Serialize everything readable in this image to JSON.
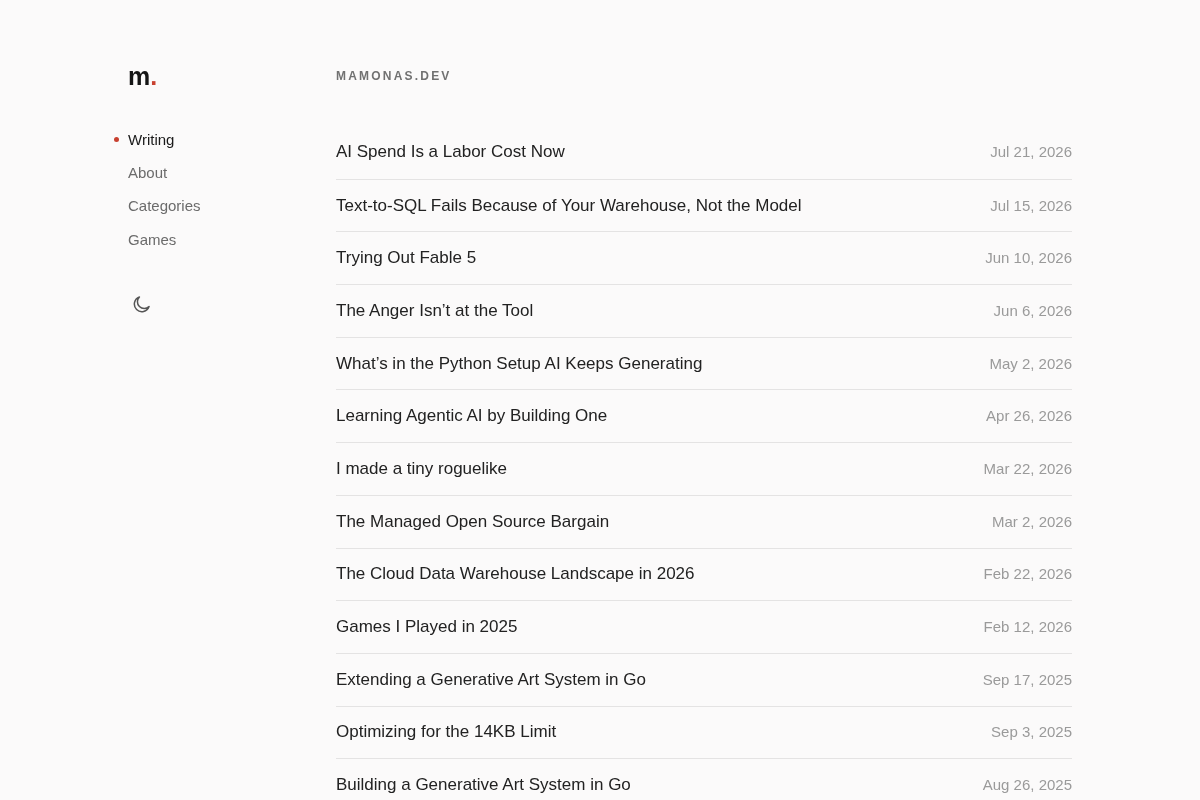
{
  "logo": {
    "letter": "m",
    "accent": "."
  },
  "nav": [
    {
      "label": "Writing",
      "selected": true
    },
    {
      "label": "About",
      "selected": false
    },
    {
      "label": "Categories",
      "selected": false
    },
    {
      "label": "Games",
      "selected": false
    }
  ],
  "site_title": "MAMONAS.DEV",
  "posts": [
    {
      "title": "AI Spend Is a Labor Cost Now",
      "date": "Jul 21, 2026"
    },
    {
      "title": "Text-to-SQL Fails Because of Your Warehouse, Not the Model",
      "date": "Jul 15, 2026"
    },
    {
      "title": "Trying Out Fable 5",
      "date": "Jun 10, 2026"
    },
    {
      "title": "The Anger Isn’t at the Tool",
      "date": "Jun 6, 2026"
    },
    {
      "title": "What’s in the Python Setup AI Keeps Generating",
      "date": "May 2, 2026"
    },
    {
      "title": "Learning Agentic AI by Building One",
      "date": "Apr 26, 2026"
    },
    {
      "title": "I made a tiny roguelike",
      "date": "Mar 22, 2026"
    },
    {
      "title": "The Managed Open Source Bargain",
      "date": "Mar 2, 2026"
    },
    {
      "title": "The Cloud Data Warehouse Landscape in 2026",
      "date": "Feb 22, 2026"
    },
    {
      "title": "Games I Played in 2025",
      "date": "Feb 12, 2026"
    },
    {
      "title": "Extending a Generative Art System in Go",
      "date": "Sep 17, 2025"
    },
    {
      "title": "Optimizing for the 14KB Limit",
      "date": "Sep 3, 2025"
    },
    {
      "title": "Building a Generative Art System in Go",
      "date": "Aug 26, 2025"
    }
  ]
}
